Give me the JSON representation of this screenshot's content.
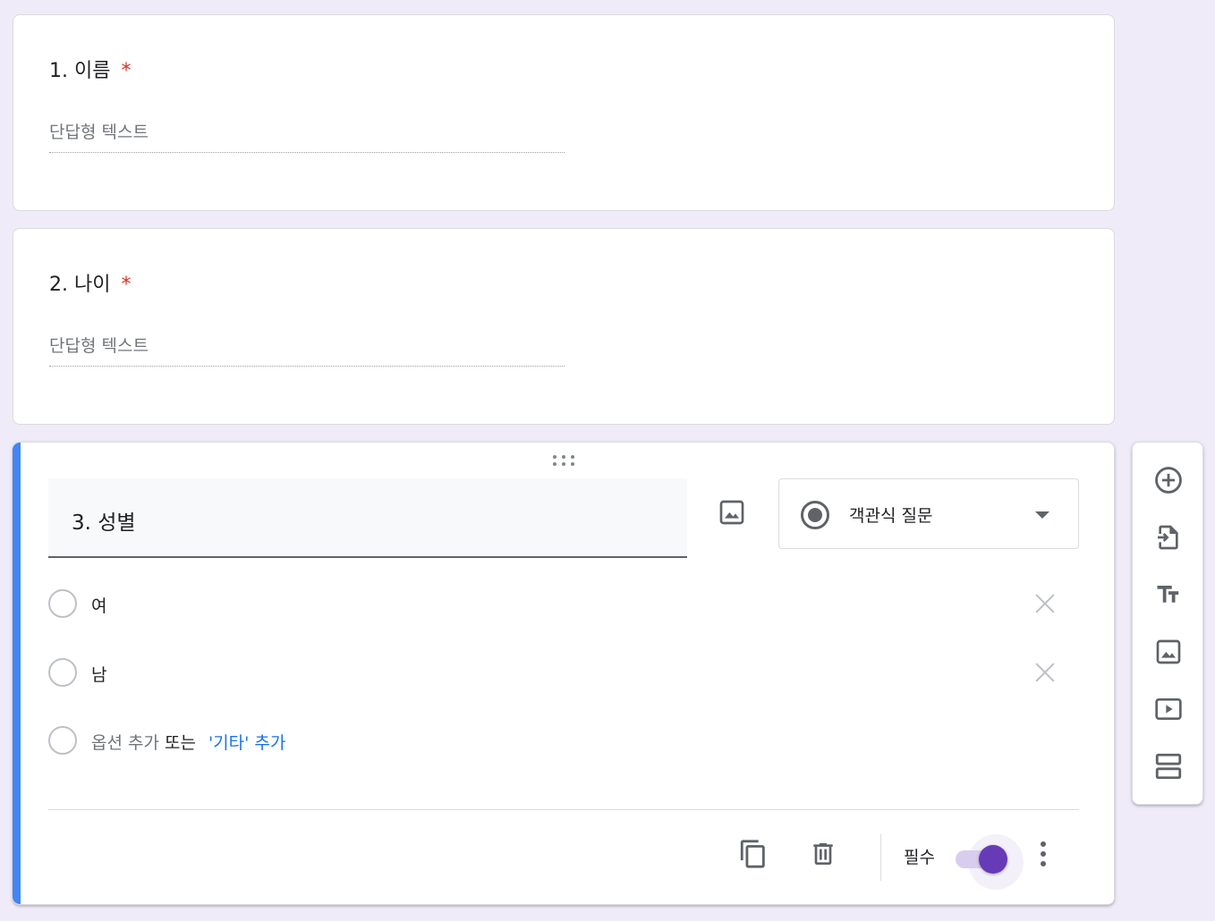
{
  "questions": [
    {
      "title": "1. 이름",
      "required_mark": "*",
      "answer_placeholder": "단답형 텍스트"
    },
    {
      "title": "2. 나이",
      "required_mark": "*",
      "answer_placeholder": "단답형 텍스트"
    }
  ],
  "active_question": {
    "title": "3. 성별",
    "type_label": "객관식 질문",
    "options": [
      "여",
      "남"
    ],
    "add_option_label": "옵션 추가",
    "or_label": "또는",
    "add_other_label": "'기타' 추가",
    "required_label": "필수",
    "required_on": true
  },
  "colors": {
    "accent": "#4285f4",
    "toggle": "#673ab7",
    "required_star": "#d93025",
    "link": "#1a73e8",
    "background": "#f0ebf8"
  },
  "icons": {
    "footer": [
      "duplicate-icon",
      "delete-icon",
      "more-vert-icon"
    ],
    "toolbar": [
      "add-question-icon",
      "import-questions-icon",
      "add-title-icon",
      "add-image-icon",
      "add-video-icon",
      "add-section-icon"
    ]
  }
}
